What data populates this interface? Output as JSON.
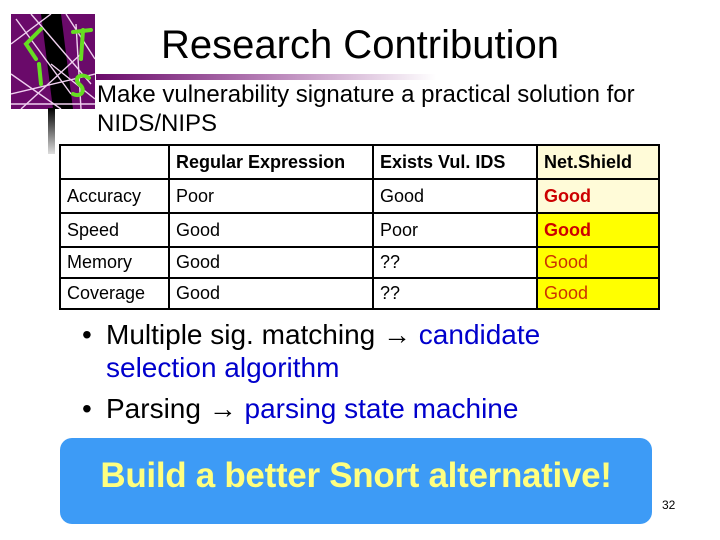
{
  "slide": {
    "title": "Research Contribution",
    "subtitle": "Make vulnerability signature a practical solution for NIDS/NIPS",
    "page_number": "32",
    "logo_icon": "lis-logo-icon"
  },
  "table": {
    "headers": [
      "",
      "Regular Expression",
      "Exists Vul. IDS",
      "Net.Shield"
    ],
    "rows": [
      {
        "label": "Accuracy",
        "regex": "Poor",
        "vul_ids": "Good",
        "netshield": "Good"
      },
      {
        "label": "Speed",
        "regex": "Good",
        "vul_ids": "Poor",
        "netshield": "Good"
      },
      {
        "label": "Memory",
        "regex": "Good",
        "vul_ids": "??",
        "netshield": "Good"
      },
      {
        "label": "Coverage",
        "regex": "Good",
        "vul_ids": "??",
        "netshield": "Good"
      }
    ]
  },
  "bullets": [
    {
      "bullet": "•",
      "lead": "Multiple sig. matching ",
      "arrow": "→",
      "result": " candidate selection algorithm"
    },
    {
      "bullet": "•",
      "lead": "Parsing ",
      "arrow": "→",
      "result": " parsing state machine"
    }
  ],
  "callout": {
    "text": "Build a better Snort alternative!"
  },
  "colors": {
    "logo_purple": "#6a0a6a",
    "logo_green": "#66dd22",
    "netshield_pale": "#fffbd8",
    "netshield_yellow": "#ffff00",
    "good_red": "#cc0000",
    "result_blue": "#0000cc",
    "callout_bg": "#3d9bf6",
    "callout_text": "#ffff80"
  }
}
